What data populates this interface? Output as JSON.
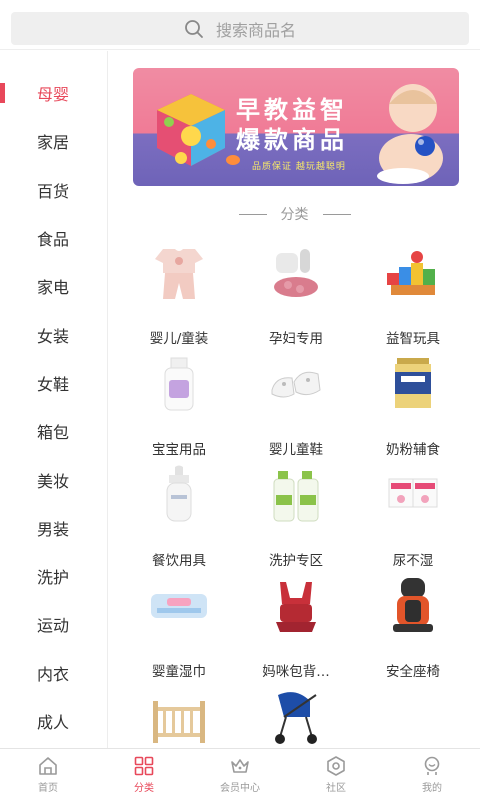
{
  "search": {
    "placeholder": "搜索商品名"
  },
  "sidebar": {
    "items": [
      {
        "label": "母婴",
        "active": true
      },
      {
        "label": "家居"
      },
      {
        "label": "百货"
      },
      {
        "label": "食品"
      },
      {
        "label": "家电"
      },
      {
        "label": "女装"
      },
      {
        "label": "女鞋"
      },
      {
        "label": "箱包"
      },
      {
        "label": "美妆"
      },
      {
        "label": "男装"
      },
      {
        "label": "洗护"
      },
      {
        "label": "运动"
      },
      {
        "label": "内衣"
      },
      {
        "label": "成人"
      }
    ]
  },
  "banner": {
    "line1": "早教益智",
    "line2": "爆款商品",
    "subtitle": "品质保证  越玩越聪明"
  },
  "section_title": "分类",
  "categories": [
    {
      "label": "婴儿/童装",
      "icon": "baby-clothes-icon"
    },
    {
      "label": "孕妇专用",
      "icon": "maternity-icon"
    },
    {
      "label": "益智玩具",
      "icon": "toy-blocks-icon"
    },
    {
      "label": "宝宝用品",
      "icon": "baby-lotion-icon"
    },
    {
      "label": "婴儿童鞋",
      "icon": "baby-shoes-icon"
    },
    {
      "label": "奶粉辅食",
      "icon": "milk-powder-icon"
    },
    {
      "label": "餐饮用具",
      "icon": "baby-bottle-icon"
    },
    {
      "label": "洗护专区",
      "icon": "detergent-icon"
    },
    {
      "label": "尿不湿",
      "icon": "diapers-icon"
    },
    {
      "label": "婴童湿巾",
      "icon": "wet-wipes-icon"
    },
    {
      "label": "妈咪包背…",
      "icon": "baby-carrier-icon"
    },
    {
      "label": "安全座椅",
      "icon": "car-seat-icon"
    },
    {
      "label": "",
      "icon": "crib-icon"
    },
    {
      "label": "",
      "icon": "stroller-icon"
    }
  ],
  "bottom_nav": [
    {
      "label": "首页",
      "icon": "home-icon"
    },
    {
      "label": "分类",
      "icon": "category-icon",
      "active": true
    },
    {
      "label": "会员中心",
      "icon": "crown-icon"
    },
    {
      "label": "社区",
      "icon": "community-icon"
    },
    {
      "label": "我的",
      "icon": "profile-icon"
    }
  ],
  "colors": {
    "accent": "#e8485a"
  }
}
